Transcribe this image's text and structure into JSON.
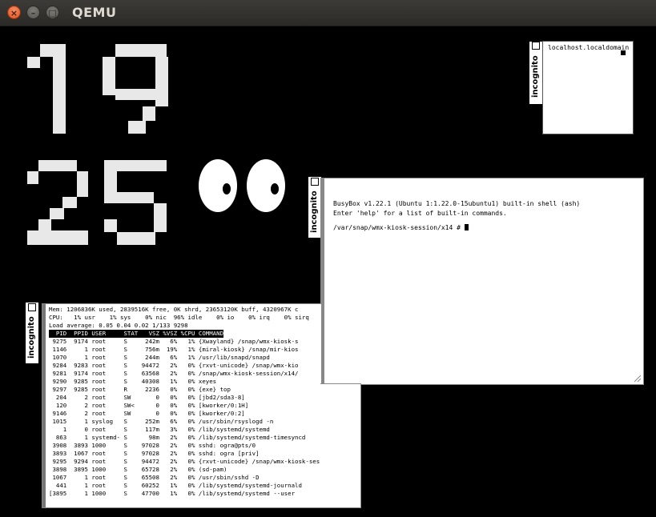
{
  "app": {
    "title": "QEMU"
  },
  "clock": {
    "hours": "19",
    "minutes": "25"
  },
  "hostname_window": {
    "tab_label": "incognito",
    "text": "localhost.localdomain"
  },
  "terminal_window": {
    "tab_label": "incognito",
    "lines": [
      "BusyBox v1.22.1 (Ubuntu 1:1.22.0-15ubuntu1) built-in shell (ash)",
      "Enter 'help' for a list of built-in commands.",
      "",
      "/var/snap/wmx-kiosk-session/x14 # "
    ]
  },
  "top_window": {
    "tab_label": "incognito",
    "summary": [
      "Mem: 1206836K used, 2839516K free, 0K shrd, 23653120K buff, 4320967K c",
      "CPU:   1% usr    1% sys    0% nic  96% idle    0% io    0% irq    0% sirq",
      "Load average: 0.05 0.04 0.02 1/133 9298"
    ],
    "header": "  PID  PPID USER     STAT   VSZ %VSZ %CPU COMMAND",
    "rows": [
      " 9275  9174 root     S     242m   6%   1% {Xwayland} /snap/wmx-kiosk-s",
      " 1146     1 root     S     756m  19%   1% {miral-kiosk} /snap/mir-kios",
      " 1070     1 root     S     244m   6%   1% /usr/lib/snapd/snapd",
      " 9284  9283 root     S    94472   2%   0% {rxvt-unicode} /snap/wmx-kio",
      " 9281  9174 root     S    63568   2%   0% /snap/wmx-kiosk-session/x14/",
      " 9290  9285 root     S    40308   1%   0% xeyes",
      " 9297  9285 root     R     2236   0%   0% {exe} top",
      "  204     2 root     SW       0   0%   0% [jbd2/sda3-8]",
      "  120     2 root     SW<      0   0%   0% [kworker/0:1H]",
      " 9146     2 root     SW       0   0%   0% [kworker/0:2]",
      " 1015     1 syslog   S     252m   6%   0% /usr/sbin/rsyslogd -n",
      "    1     0 root     S     117m   3%   0% /lib/systemd/systemd",
      "  863     1 systemd- S      98m   2%   0% /lib/systemd/systemd-timesyncd",
      " 3908  3893 1000     S    97028   2%   0% sshd: ogra@pts/0",
      " 3893  1067 root     S    97028   2%   0% sshd: ogra [priv]",
      " 9295  9294 root     S    94472   2%   0% {rxvt-unicode} /snap/wmx-kiosk-session",
      " 3898  3895 1000     S    65728   2%   0% (sd-pam)",
      " 1067     1 root     S    65508   2%   0% /usr/sbin/sshd -D",
      "  441     1 root     S    60252   1%   0% /lib/systemd/systemd-journald",
      "[3895     1 1000     S    47700   1%   0% /lib/systemd/systemd --user"
    ]
  }
}
